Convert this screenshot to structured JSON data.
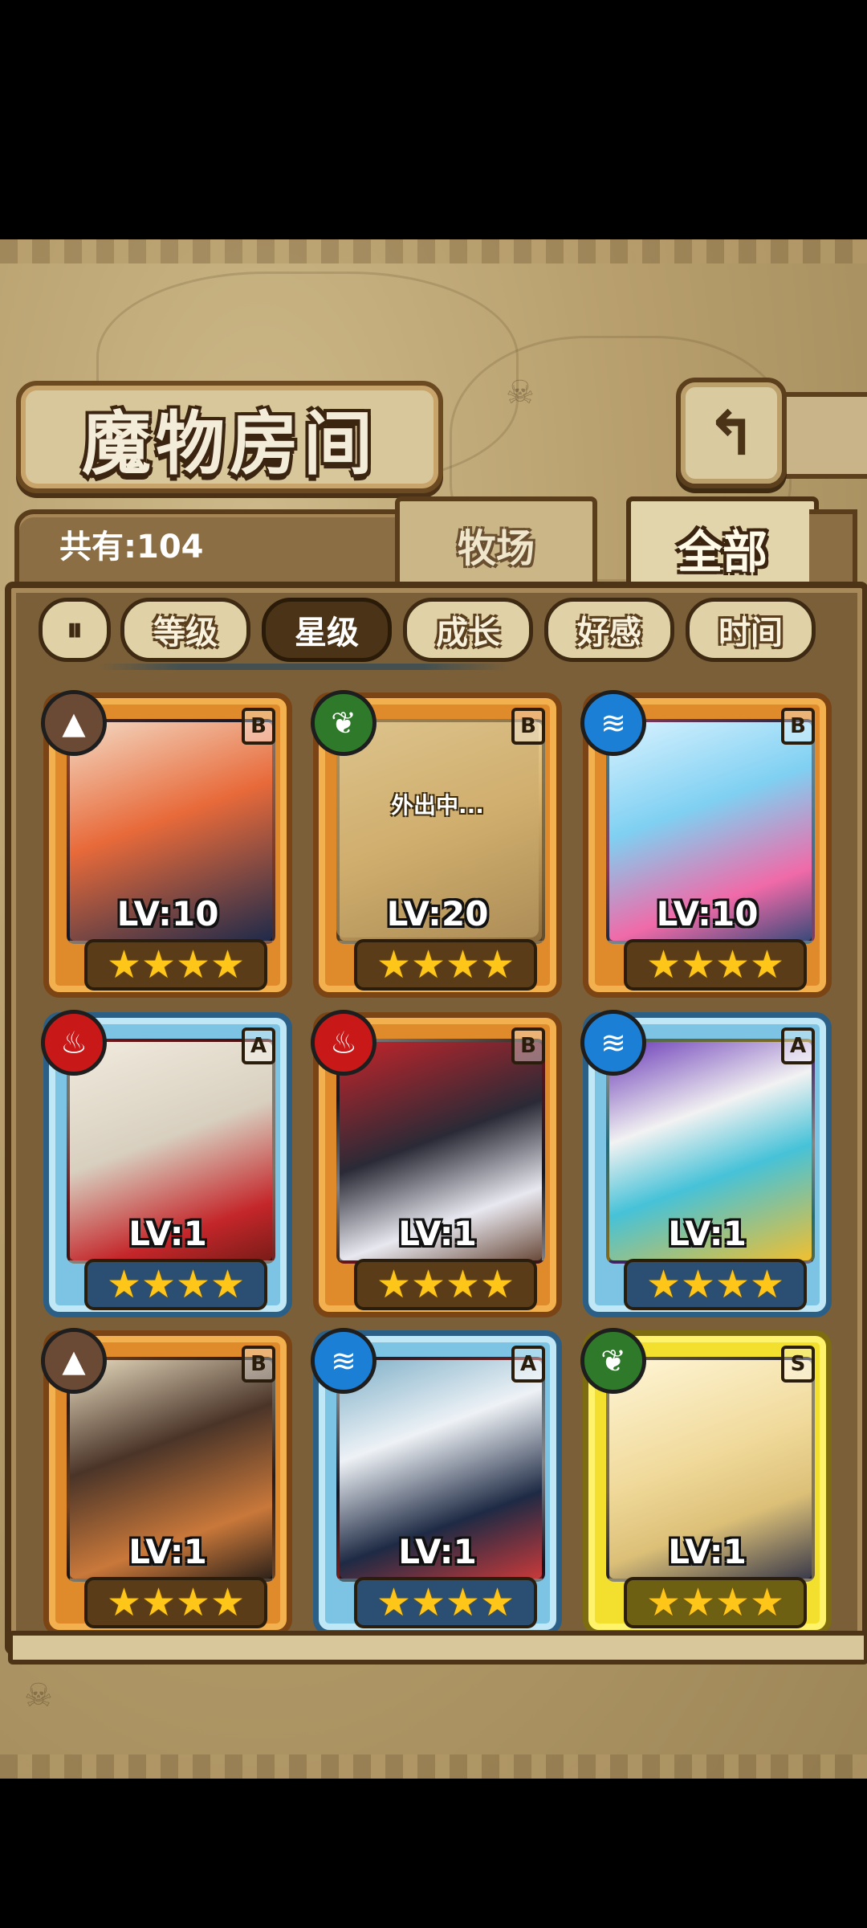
{
  "title": "魔物房间",
  "back_icon": "return-arrow-icon",
  "count_label": "共有:104",
  "tabs": {
    "ranch": "牧场",
    "all": "全部",
    "active": "全部"
  },
  "sort": {
    "toggle_icon": "sort-order-icon",
    "buttons": [
      "等级",
      "星级",
      "成长",
      "好感",
      "时间"
    ],
    "active": "星级"
  },
  "cards": [
    {
      "element": "earth",
      "grade": "B",
      "level": "LV:10",
      "stars": "★★★★",
      "frame": "bronze",
      "status": ""
    },
    {
      "element": "plant",
      "grade": "B",
      "level": "LV:20",
      "stars": "★★★★",
      "frame": "bronze",
      "status": "外出中..."
    },
    {
      "element": "water",
      "grade": "B",
      "level": "LV:10",
      "stars": "★★★★",
      "frame": "bronze",
      "status": ""
    },
    {
      "element": "fire",
      "grade": "A",
      "level": "LV:1",
      "stars": "★★★★",
      "frame": "silver",
      "status": ""
    },
    {
      "element": "fire",
      "grade": "B",
      "level": "LV:1",
      "stars": "★★★★",
      "frame": "bronze",
      "status": ""
    },
    {
      "element": "water",
      "grade": "A",
      "level": "LV:1",
      "stars": "★★★★",
      "frame": "silver",
      "status": ""
    },
    {
      "element": "earth",
      "grade": "B",
      "level": "LV:1",
      "stars": "★★★★",
      "frame": "bronze",
      "status": ""
    },
    {
      "element": "water",
      "grade": "A",
      "level": "LV:1",
      "stars": "★★★★",
      "frame": "silver",
      "status": ""
    },
    {
      "element": "plant",
      "grade": "S",
      "level": "LV:1",
      "stars": "★★★★",
      "frame": "gold",
      "status": ""
    }
  ],
  "colors": {
    "bronze": "#e08b2b",
    "silver": "#7dc4e4",
    "gold": "#f2df2e",
    "earth": "#6b4a35",
    "plant": "#2f7a2a",
    "water": "#1b7fd6",
    "fire": "#c81818"
  }
}
